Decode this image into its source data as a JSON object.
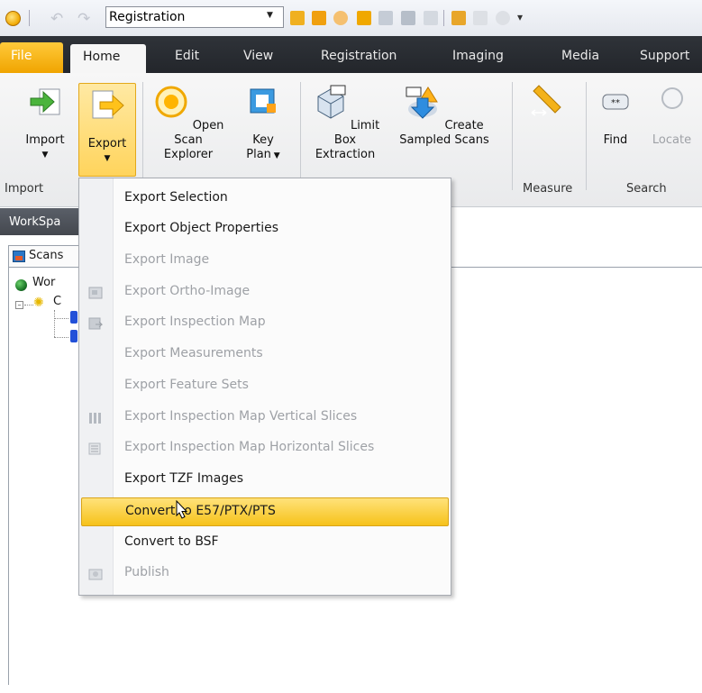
{
  "qat": {
    "combo_value": "Registration"
  },
  "tabs": {
    "file": "File",
    "home": "Home",
    "edit": "Edit",
    "view": "View",
    "registration": "Registration",
    "imaging": "Imaging",
    "media": "Media",
    "support": "Support"
  },
  "ribbon": {
    "import_label": "Import",
    "export_label": "Export",
    "open_scan_line1": "Open Scan",
    "open_scan_line2": "Explorer",
    "key_plan_line1": "Key",
    "key_plan_line2": "Plan",
    "limit_box_line1": "Limit Box",
    "limit_box_line2": "Extraction",
    "create_line1": "Create",
    "create_line2": "Sampled Scans",
    "find_label": "Find",
    "locate_label": "Locate",
    "groups": {
      "import": "Import",
      "measure": "Measure",
      "search": "Search"
    }
  },
  "workspace": {
    "header": "WorkSpa",
    "tab": "Scans",
    "tree_root": "Wor",
    "tree_child": "C"
  },
  "menu": {
    "items": [
      {
        "label": "Export Selection",
        "enabled": true,
        "icon": "none"
      },
      {
        "label": "Export Object Properties",
        "enabled": true,
        "icon": "none"
      },
      {
        "label": "Export Image",
        "enabled": false,
        "icon": "none"
      },
      {
        "label": "Export Ortho-Image",
        "enabled": false,
        "icon": "ortho-image-icon"
      },
      {
        "label": "Export Inspection Map",
        "enabled": false,
        "icon": "inspection-map-icon"
      },
      {
        "label": "Export Measurements",
        "enabled": false,
        "icon": "none"
      },
      {
        "label": "Export Feature Sets",
        "enabled": false,
        "icon": "none"
      },
      {
        "label": "Export Inspection Map Vertical Slices",
        "enabled": false,
        "icon": "vertical-slices-icon"
      },
      {
        "label": "Export Inspection Map Horizontal Slices",
        "enabled": false,
        "icon": "horizontal-slices-icon"
      },
      {
        "label": "Export TZF Images",
        "enabled": true,
        "icon": "none"
      },
      {
        "label": "Convert to E57/PTX/PTS",
        "enabled": true,
        "highlighted": true,
        "icon": "none"
      },
      {
        "label": "Convert to BSF",
        "enabled": true,
        "icon": "none"
      },
      {
        "label": "Publish",
        "enabled": false,
        "icon": "publish-icon"
      }
    ]
  },
  "colors": {
    "accent_file_tab": "#f0a400",
    "highlight": "#f6c21a",
    "ribbon_dark": "#2f3339",
    "disabled_text": "#9ea1a6"
  }
}
